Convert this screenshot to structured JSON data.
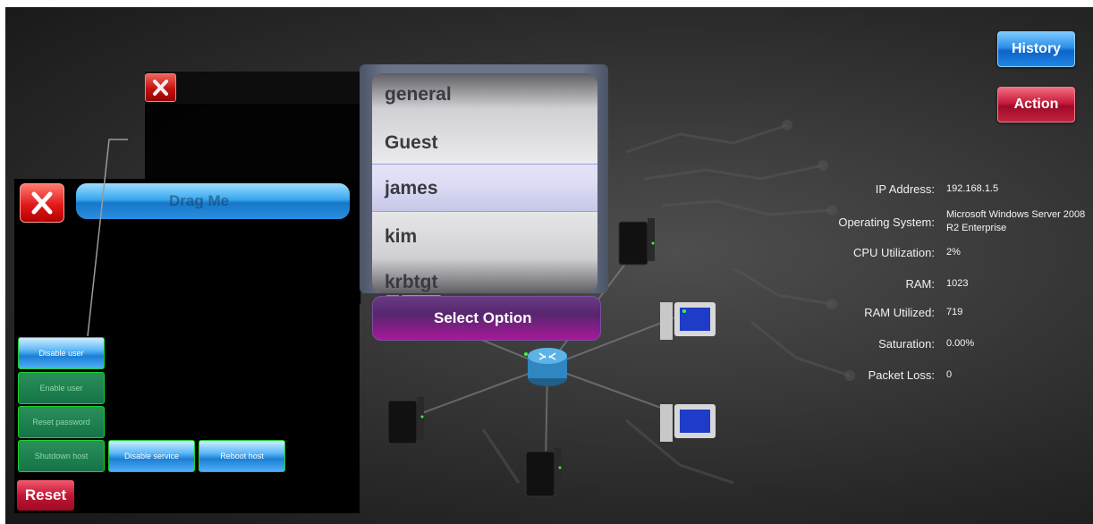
{
  "top_buttons": {
    "history": "History",
    "action": "Action"
  },
  "info": {
    "ip_label": "IP Address:",
    "ip_value": "192.168.1.5",
    "os_label": "Operating System:",
    "os_value": "Microsoft Windows Server 2008 R2 Enterprise",
    "cpu_label": "CPU Utilization:",
    "cpu_value": "2%",
    "ram_label": "RAM:",
    "ram_value": "1023",
    "ram_used_label": "RAM Utilized:",
    "ram_used_value": "719",
    "sat_label": "Saturation:",
    "sat_value": "0.00%",
    "loss_label": "Packet Loss:",
    "loss_value": "0"
  },
  "panel": {
    "drag_label": "Drag Me",
    "actions": {
      "disable_user": "Disable user",
      "enable_user": "Enable user",
      "reset_password": "Reset password",
      "shutdown_host": "Shutdown host",
      "disable_service": "Disable service",
      "reboot_host": "Reboot host"
    },
    "reset": "Reset"
  },
  "picker": {
    "items": [
      "general",
      "Guest",
      "james",
      "kim",
      "krbtgt"
    ],
    "selected": "james",
    "select_button": "Select Option"
  },
  "colors": {
    "accent_blue": "#2a8fe8",
    "accent_red": "#c81c3b",
    "action_border": "#19d12e"
  }
}
